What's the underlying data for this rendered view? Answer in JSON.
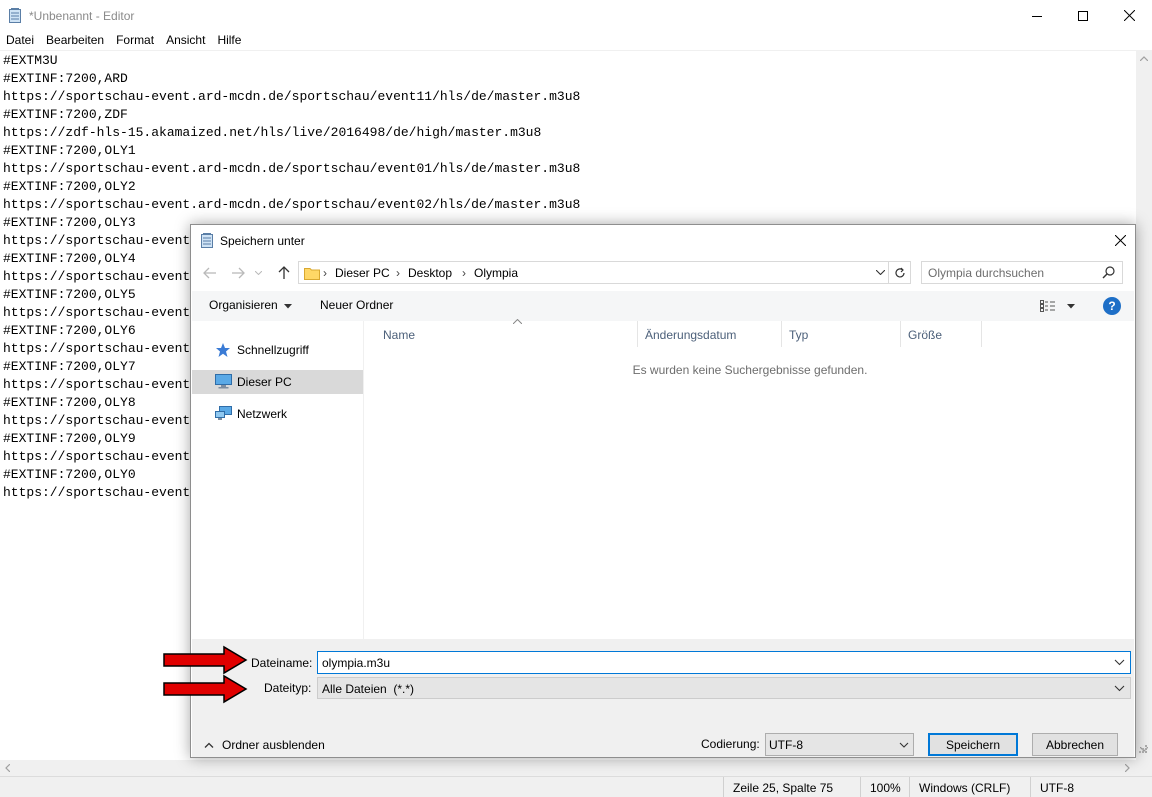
{
  "notepad": {
    "title": "*Unbenannt - Editor",
    "menu": [
      "Datei",
      "Bearbeiten",
      "Format",
      "Ansicht",
      "Hilfe"
    ],
    "lines": [
      "#EXTM3U",
      "#EXTINF:7200,ARD",
      "https://sportschau-event.ard-mcdn.de/sportschau/event11/hls/de/master.m3u8",
      "#EXTINF:7200,ZDF",
      "https://zdf-hls-15.akamaized.net/hls/live/2016498/de/high/master.m3u8",
      "#EXTINF:7200,OLY1",
      "https://sportschau-event.ard-mcdn.de/sportschau/event01/hls/de/master.m3u8",
      "#EXTINF:7200,OLY2",
      "https://sportschau-event.ard-mcdn.de/sportschau/event02/hls/de/master.m3u8",
      "#EXTINF:7200,OLY3",
      "https://sportschau-event",
      "#EXTINF:7200,OLY4",
      "https://sportschau-event",
      "#EXTINF:7200,OLY5",
      "https://sportschau-event",
      "#EXTINF:7200,OLY6",
      "https://sportschau-event",
      "#EXTINF:7200,OLY7",
      "https://sportschau-event",
      "#EXTINF:7200,OLY8",
      "https://sportschau-event",
      "#EXTINF:7200,OLY9",
      "https://sportschau-event",
      "#EXTINF:7200,OLY0",
      "https://sportschau-event"
    ],
    "status": {
      "position": "Zeile 25, Spalte 75",
      "zoom": "100%",
      "line_ending": "Windows (CRLF)",
      "encoding": "UTF-8"
    }
  },
  "dialog": {
    "title": "Speichern unter",
    "breadcrumb": [
      "Dieser PC",
      "Desktop",
      "Olympia"
    ],
    "search_placeholder": "Olympia durchsuchen",
    "toolbar": {
      "organize": "Organisieren",
      "new_folder": "Neuer Ordner",
      "help": "?"
    },
    "nav": [
      "Schnellzugriff",
      "Dieser PC",
      "Netzwerk"
    ],
    "selected_nav": "Dieser PC",
    "columns": [
      "Name",
      "Änderungsdatum",
      "Typ",
      "Größe"
    ],
    "empty_message": "Es wurden keine Suchergebnisse gefunden.",
    "filename_label": "Dateiname:",
    "filename_value": "olympia.m3u",
    "filetype_label": "Dateityp:",
    "filetype_value": "Alle Dateien  (*.*)",
    "hide_folders": "Ordner ausblenden",
    "encoding_label": "Codierung:",
    "encoding_value": "UTF-8",
    "save_button": "Speichern",
    "cancel_button": "Abbrechen"
  },
  "colors": {
    "accent": "#0078d7",
    "annotation_arrow": "#e00000",
    "selection": "#d9d9d9"
  }
}
